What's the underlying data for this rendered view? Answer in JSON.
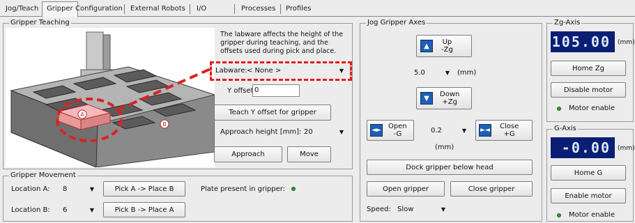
{
  "tabs": [
    "Jog/Teach",
    "Gripper",
    "Configuration",
    "External Robots",
    "I/O",
    "Processes",
    "Profiles"
  ],
  "gripper_teaching": {
    "title": "Gripper Teaching",
    "description": "The labware affects the height of the gripper during teaching, and the offsets used during pick and place.",
    "labware_label": "Labware:",
    "labware_value": "< None >",
    "y_offset_label": "Y offset:",
    "y_offset_value": "0",
    "teach_button": "Teach Y offset for gripper",
    "approach_height_label": "Approach height [mm]:",
    "approach_height_value": "20",
    "approach_button": "Approach",
    "move_button": "Move",
    "marker_a": "A",
    "marker_b": "B"
  },
  "jog_gripper": {
    "title": "Jog Gripper Axes",
    "up_line1": "Up",
    "up_line2": "-Zg",
    "step_value": "5.0",
    "step_unit": "(mm)",
    "down_line1": "Down",
    "down_line2": "+Zg",
    "open_line1": "Open",
    "open_line2": "-G",
    "g_step_value": "0.2",
    "g_step_unit": "(mm)",
    "close_line1": "Close",
    "close_line2": "+G",
    "dock_button": "Dock gripper below head",
    "open_gripper_button": "Open gripper",
    "close_gripper_button": "Close gripper",
    "speed_label": "Speed:",
    "speed_value": "Slow"
  },
  "zg_axis": {
    "title": "Zg-Axis",
    "value": "105.00",
    "unit": "(mm)",
    "home_button": "Home Zg",
    "disable_button": "Disable motor",
    "status": "Motor enable"
  },
  "g_axis": {
    "title": "G-Axis",
    "value": "-0.00",
    "unit": "(mm)",
    "home_button": "Home G",
    "enable_button": "Enable motor",
    "status": "Motor enable"
  },
  "gripper_movement": {
    "title": "Gripper Movement",
    "location_a_label": "Location A:",
    "location_a_value": "8",
    "location_b_label": "Location B:",
    "location_b_value": "6",
    "pick_a_button": "Pick A -> Place B",
    "pick_b_button": "Pick B -> Place A",
    "plate_label": "Plate present in gripper:"
  },
  "colors": {
    "highlight": "#e02020",
    "display_bg": "#0a1f73",
    "icon_blue": "#1d5fb3",
    "led_green": "#2d9a3a"
  }
}
